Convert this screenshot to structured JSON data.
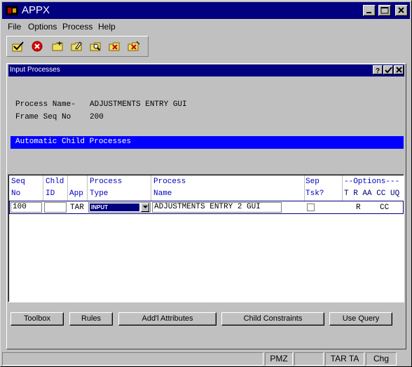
{
  "app": {
    "title": "APPX",
    "controls": [
      "minimize-icon",
      "maximize-icon",
      "close-icon"
    ]
  },
  "menu": {
    "items": [
      "File",
      "Options",
      "Process",
      "Help"
    ]
  },
  "toolbar": {
    "icons": [
      "checkmark-icon",
      "cancel-icon",
      "new-folder-icon",
      "edit-folder-icon",
      "search-folder-icon",
      "delete-folder-icon",
      "purge-folder-icon"
    ]
  },
  "child_window": {
    "title": "Input Processes",
    "controls": [
      "help-icon",
      "check-icon",
      "close-icon"
    ]
  },
  "form": {
    "process_name_label": "Process Name-",
    "process_name_value": "ADJUSTMENTS ENTRY GUI",
    "frame_seq_label": "Frame Seq No",
    "frame_seq_value": "200",
    "section_title": "Automatic Child Processes"
  },
  "table": {
    "headers": {
      "seq_1": "Seq",
      "seq_2": "No",
      "chld_1": "Chld",
      "chld_2": "ID",
      "app": "App",
      "ptype_1": "Process",
      "ptype_2": "Type",
      "pname_1": "Process",
      "pname_2": "Name",
      "sep_1": "Sep",
      "sep_2": "Tsk?",
      "options_1": "--Options---",
      "options_2": "T R AA CC UQ"
    },
    "row": {
      "seq": "100",
      "chld": "",
      "app": "TAR",
      "process_type": "INPUT",
      "process_name": "ADJUSTMENTS ENTRY 2 GUI",
      "sep_task": false,
      "opt_r": "R",
      "opt_cc": "CC"
    }
  },
  "buttons": {
    "toolbox": "Toolbox",
    "rules": "Rules",
    "attributes": "Add'l Attributes",
    "constraints": "Child Constraints",
    "query": "Use Query"
  },
  "status": {
    "panel_1": "",
    "panel_2": "PMZ",
    "panel_3": "",
    "panel_4": "TAR TA",
    "panel_5": "Chg"
  }
}
